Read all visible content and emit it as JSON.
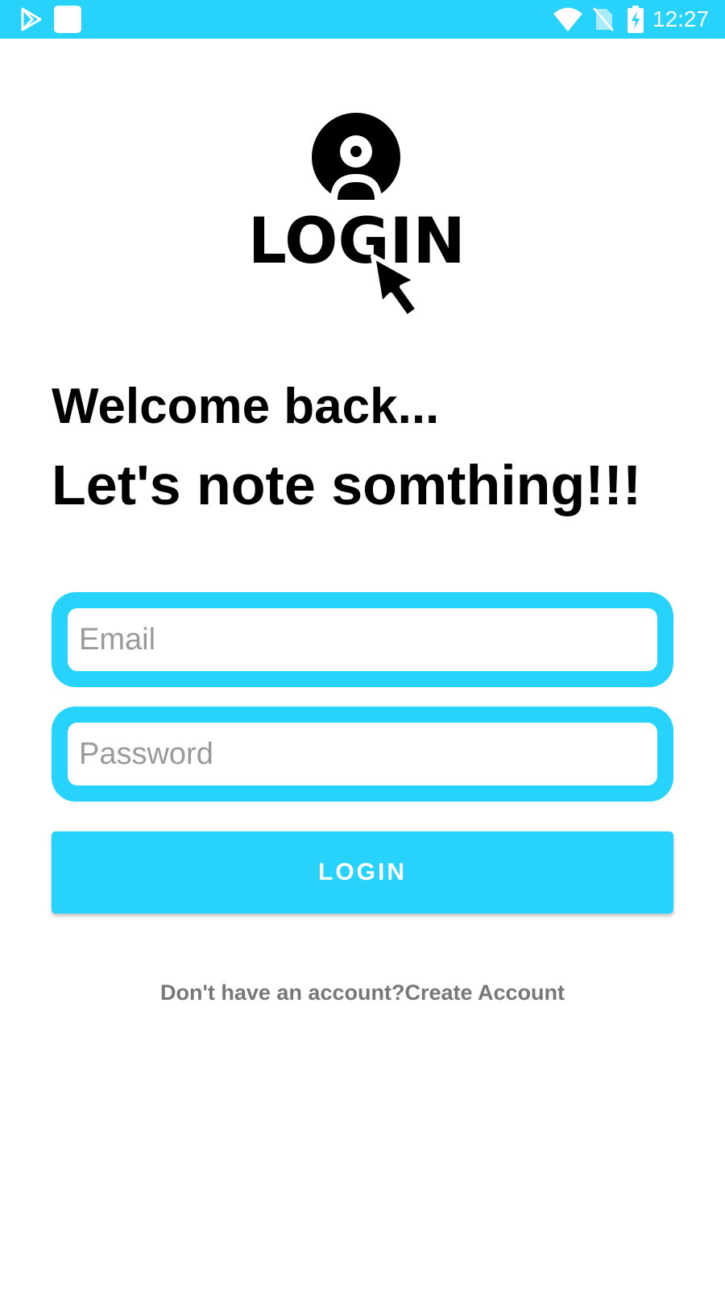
{
  "status_bar": {
    "time": "12:27",
    "background_color": "#27d3fb",
    "icons": [
      "play-store-icon",
      "app-square-icon",
      "wifi-icon",
      "no-sim-icon",
      "battery-charging-icon"
    ]
  },
  "logo": {
    "text": "LOGIN",
    "icons": [
      "user-avatar-icon",
      "cursor-arrow-icon"
    ]
  },
  "heading": {
    "welcome": "Welcome back...",
    "tagline": "Let's note somthing!!!"
  },
  "form": {
    "email_placeholder": "Email",
    "email_value": "",
    "password_placeholder": "Password",
    "password_value": ""
  },
  "login_button": {
    "label": "LOGIN"
  },
  "signup": {
    "prompt": "Don't have an account?",
    "link_label": "Create Account"
  },
  "colors": {
    "accent": "#27d3fb",
    "footer_text": "#777777"
  }
}
